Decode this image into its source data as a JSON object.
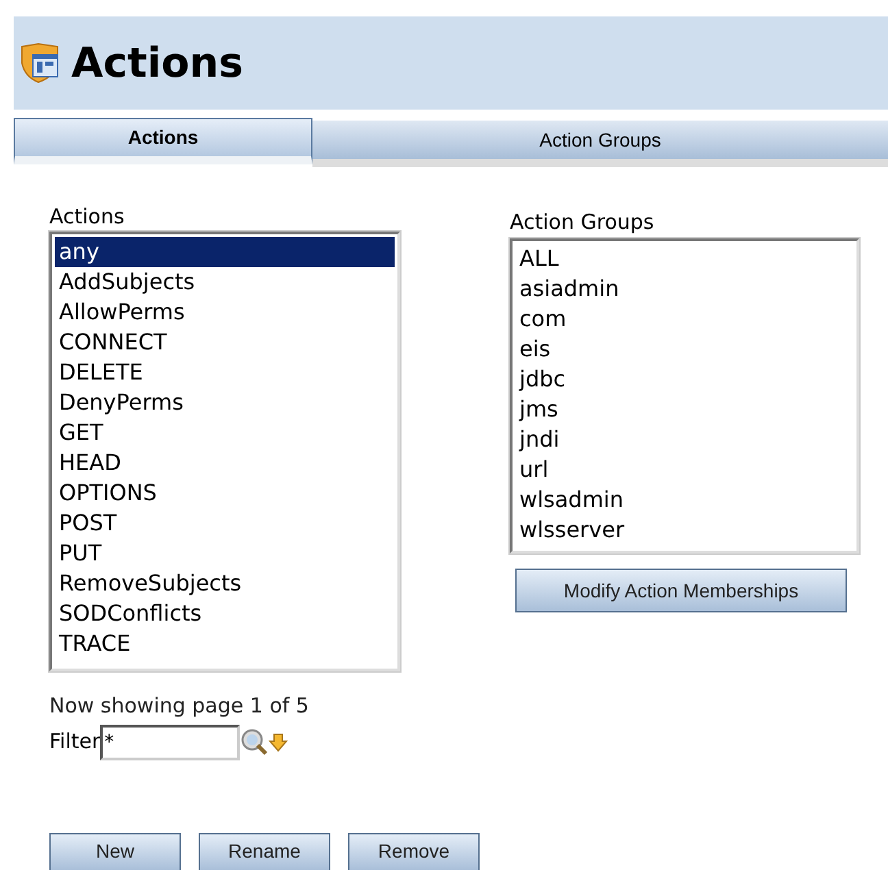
{
  "header": {
    "title": "Actions"
  },
  "tabs": [
    {
      "label": "Actions",
      "selected": true
    },
    {
      "label": "Action Groups",
      "selected": false
    }
  ],
  "actions": {
    "label": "Actions",
    "items": [
      {
        "label": "any",
        "selected": true
      },
      {
        "label": "AddSubjects",
        "selected": false
      },
      {
        "label": "AllowPerms",
        "selected": false
      },
      {
        "label": "CONNECT",
        "selected": false
      },
      {
        "label": "DELETE",
        "selected": false
      },
      {
        "label": "DenyPerms",
        "selected": false
      },
      {
        "label": "GET",
        "selected": false
      },
      {
        "label": "HEAD",
        "selected": false
      },
      {
        "label": "OPTIONS",
        "selected": false
      },
      {
        "label": "POST",
        "selected": false
      },
      {
        "label": "PUT",
        "selected": false
      },
      {
        "label": "RemoveSubjects",
        "selected": false
      },
      {
        "label": "SODConflicts",
        "selected": false
      },
      {
        "label": "TRACE",
        "selected": false
      }
    ],
    "paging": "Now showing page 1 of 5",
    "filter_label": "Filter",
    "filter_value": "*"
  },
  "action_groups": {
    "label": "Action Groups",
    "items": [
      {
        "label": "ALL",
        "selected": false
      },
      {
        "label": "asiadmin",
        "selected": false
      },
      {
        "label": "com",
        "selected": false
      },
      {
        "label": "eis",
        "selected": false
      },
      {
        "label": "jdbc",
        "selected": false
      },
      {
        "label": "jms",
        "selected": false
      },
      {
        "label": "jndi",
        "selected": false
      },
      {
        "label": "url",
        "selected": false
      },
      {
        "label": "wlsadmin",
        "selected": false
      },
      {
        "label": "wlsserver",
        "selected": false
      }
    ],
    "button": "Modify Action Memberships"
  },
  "buttons": [
    "New",
    "Rename",
    "Remove"
  ]
}
